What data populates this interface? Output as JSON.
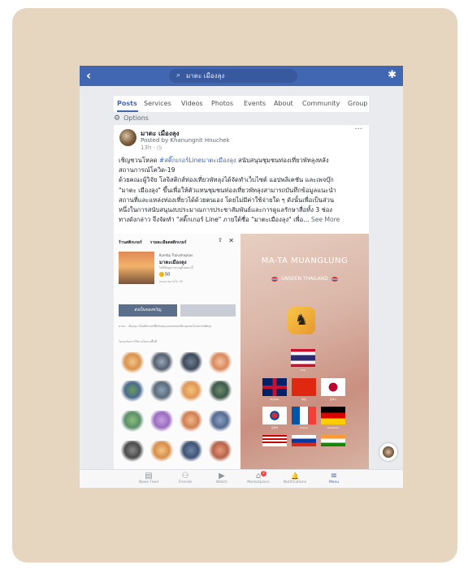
{
  "topbar": {
    "back_icon": "‹",
    "search_icon": "⌕",
    "search_text": "มาตะ เมืองลุง",
    "settings_icon": "✱"
  },
  "tabs": [
    "Posts",
    "Services",
    "Videos",
    "Photos",
    "Events",
    "About",
    "Community",
    "Group"
  ],
  "options_label": "Options",
  "post": {
    "page_name": "มาตะ เมืองลุง",
    "posted_by": "Posted by Khanungnit Hnuchek",
    "time": "13h · ◷",
    "more_icon": "···",
    "line1_a": "เชิญชวนโหลด ",
    "line1_hashtag": "#สติ๊กเกอร์Lineมาตะเมืองลุง",
    "line1_b": " สนับสนุนชุมชนท่องเที่ยวพัทลุงหลัง",
    "line2": "สถานการณ์โควิด-19",
    "line3": "ด้วยคณะผู้วิจัย โลจิสติกส์ท่องเที่ยวพัทลุงได้จัดทำเว็บไซต์ แอปพลิเคชัน และเพจบุ๊ก",
    "line4": "\"มาตะ เมืองลุง\" ขึ้นเพื่อให้ตัวแทนชุมชนท่องเที่ยวพัทลุงสามารถบันทึกข้อมูลแนะนำ",
    "line5": "สถานที่และแหล่งท่องเที่ยวได้ด้วยตนเอง โดยไม่มีค่าใช้จ่ายใด ๆ ดังนั้นเพื่อเป็นส่วน",
    "line6": "หนึ่งในการสนับสนุนงบประมาณการประชาสัมพันธ์และการดูแลรักษาสื่อทั้ง 3 ช่อง",
    "line7": "ทางดังกล่าว จึงจัดทำ \"สติ๊กเกอร์ Line\" ภายใต้ชื่อ \"มาตะเมืองลุง\" เพื่อ...",
    "see_more": "See More"
  },
  "sticker_shop": {
    "tab1": "ร้านสติกเกอร์",
    "tab2": "รายละเอียดสติกเกอร์",
    "share_icon": "⇧",
    "close_icon": "✕",
    "author": "Kumtip Traiushaykas",
    "title": "มาตะเมืองลุง",
    "subtitle": "ไม่มีข้อมูลราคาอยู่ในขณะนี้",
    "price": "50",
    "note": "หมดอายุภายใน 90",
    "buy_label": "ส่งเป็นของขวัญ",
    "description": "มาตะ - เมืองลุง เป็นสติกเกอร์ที่สนับสนุนแหล่งท่องเที่ยวชุมชนในจังหวัดพัทลุง",
    "description2": "ไม่รองรับการใช้งานในบางพื้นที่"
  },
  "poster": {
    "title": "MA-TA MUANGLUNG",
    "subtitle": "UNSEEN THAILAND",
    "flags": [
      "Thai",
      "English",
      "中文",
      "日本人",
      "한국어",
      "France",
      "Deutsche"
    ]
  },
  "bottom_nav": [
    {
      "label": "News Feed",
      "icon": "▤"
    },
    {
      "label": "Friends",
      "icon": "⚇"
    },
    {
      "label": "Watch",
      "icon": "▶"
    },
    {
      "label": "Marketplace",
      "icon": "⌂",
      "badge": "2"
    },
    {
      "label": "Notifications",
      "icon": "🔔"
    },
    {
      "label": "Menu",
      "icon": "≡"
    }
  ],
  "colors": {
    "brand": "#4267b2",
    "card_bg": "#e6d5bf"
  }
}
